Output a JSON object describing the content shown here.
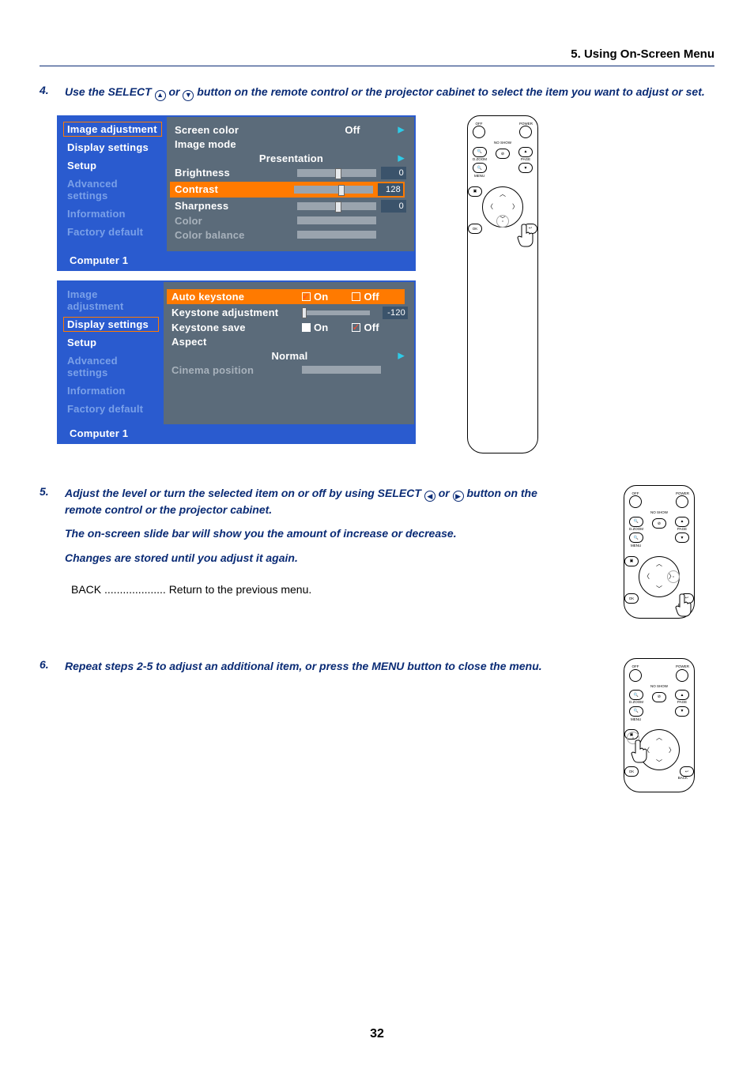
{
  "header": {
    "section_title": "5. Using On-Screen Menu"
  },
  "step4": {
    "number": "4.",
    "text_a": "Use the SELECT ",
    "text_b": " or ",
    "text_c": " button on the remote control or the projector cabinet to select the item you want to adjust or set."
  },
  "osd1": {
    "side": [
      {
        "label": "Image adjustment",
        "state": "sel"
      },
      {
        "label": "Display settings",
        "state": ""
      },
      {
        "label": "Setup",
        "state": ""
      },
      {
        "label": "Advanced settings",
        "state": "dim"
      },
      {
        "label": "Information",
        "state": "dim"
      },
      {
        "label": "Factory default",
        "state": "dim"
      }
    ],
    "screen_color_lbl": "Screen color",
    "screen_color_val": "Off",
    "image_mode_lbl": "Image mode",
    "image_mode_val": "Presentation",
    "brightness_lbl": "Brightness",
    "brightness_val": "0",
    "contrast_lbl": "Contrast",
    "contrast_val": "128",
    "sharpness_lbl": "Sharpness",
    "sharpness_val": "0",
    "color_lbl": "Color",
    "colorbal_lbl": "Color balance",
    "footer": "Computer 1"
  },
  "osd2": {
    "side": [
      {
        "label": "Image adjustment",
        "state": "dim"
      },
      {
        "label": "Display settings",
        "state": "sel"
      },
      {
        "label": "Setup",
        "state": ""
      },
      {
        "label": "Advanced settings",
        "state": "dim"
      },
      {
        "label": "Information",
        "state": "dim"
      },
      {
        "label": "Factory default",
        "state": "dim"
      }
    ],
    "auto_key_lbl": "Auto keystone",
    "on": "On",
    "off": "Off",
    "key_adj_lbl": "Keystone adjustment",
    "key_adj_val": "-120",
    "key_save_lbl": "Keystone save",
    "aspect_lbl": "Aspect",
    "aspect_val": "Normal",
    "cinema_lbl": "Cinema position",
    "footer": "Computer 1"
  },
  "step5": {
    "number": "5.",
    "line1a": "Adjust the level or turn the selected item on or off by using SELECT ",
    "line1b": " or ",
    "line1c": " button on the remote control or the projector cabinet.",
    "line2": "The on-screen slide bar will show you the amount of increase or decrease.",
    "line3": "Changes are stored until you adjust it again.",
    "back_line": "BACK .................... Return to the previous menu."
  },
  "step6": {
    "number": "6.",
    "text": "Repeat steps 2-5 to adjust an additional item, or press the MENU button to close the menu."
  },
  "remote": {
    "off": "OFF",
    "power": "POWER",
    "noshow": "NO SHOW",
    "dzoom": "D.ZOOM",
    "page": "PAGE",
    "menu": "MENU",
    "ok": "OK",
    "back": "BACK"
  },
  "page_number": "32"
}
